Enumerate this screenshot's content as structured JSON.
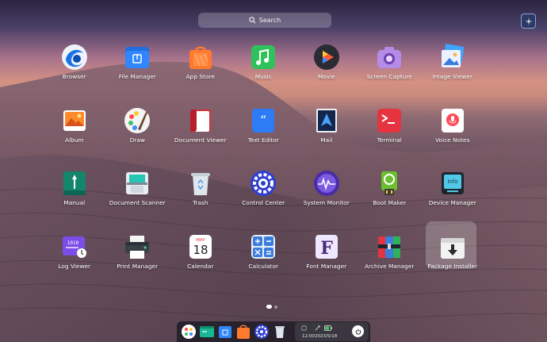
{
  "search": {
    "placeholder": "Search"
  },
  "apps": [
    {
      "label": "Browser",
      "icon": "browser-icon"
    },
    {
      "label": "File Manager",
      "icon": "file-manager-icon"
    },
    {
      "label": "App Store",
      "icon": "app-store-icon"
    },
    {
      "label": "Music",
      "icon": "music-icon"
    },
    {
      "label": "Movie",
      "icon": "movie-icon"
    },
    {
      "label": "Screen Capture",
      "icon": "camera-icon"
    },
    {
      "label": "Image Viewer",
      "icon": "image-viewer-icon"
    },
    {
      "label": "Album",
      "icon": "album-icon"
    },
    {
      "label": "Draw",
      "icon": "draw-icon"
    },
    {
      "label": "Document Viewer",
      "icon": "document-viewer-icon"
    },
    {
      "label": "Text Editor",
      "icon": "text-editor-icon"
    },
    {
      "label": "Mail",
      "icon": "mail-icon"
    },
    {
      "label": "Terminal",
      "icon": "terminal-icon"
    },
    {
      "label": "Voice Notes",
      "icon": "voice-notes-icon"
    },
    {
      "label": "Manual",
      "icon": "manual-icon"
    },
    {
      "label": "Document Scanner",
      "icon": "scanner-icon"
    },
    {
      "label": "Trash",
      "icon": "trash-icon"
    },
    {
      "label": "Control Center",
      "icon": "control-center-icon"
    },
    {
      "label": "System Monitor",
      "icon": "system-monitor-icon"
    },
    {
      "label": "Boot Maker",
      "icon": "boot-maker-icon"
    },
    {
      "label": "Device Manager",
      "icon": "device-manager-icon"
    },
    {
      "label": "Log Viewer",
      "icon": "log-viewer-icon"
    },
    {
      "label": "Print Manager",
      "icon": "printer-icon"
    },
    {
      "label": "Calendar",
      "icon": "calendar-icon"
    },
    {
      "label": "Calculator",
      "icon": "calculator-icon"
    },
    {
      "label": "Font Manager",
      "icon": "font-manager-icon"
    },
    {
      "label": "Archive Manager",
      "icon": "archive-icon"
    },
    {
      "label": "Package Installer",
      "icon": "package-installer-icon"
    }
  ],
  "icon_text": {
    "calendar_month": "MAY",
    "calendar_day": "18",
    "device_manager": "Info",
    "log_viewer": "1010",
    "font_manager": "F"
  },
  "selected_app": "Package Installer",
  "pager": {
    "pages": 2,
    "current": 1
  },
  "dock": {
    "items": [
      "launcher-icon",
      "terminal-icon",
      "file-manager-icon",
      "app-store-icon",
      "control-center-icon",
      "trash-icon"
    ]
  },
  "tray": {
    "time": "12:00",
    "date": "2023/5/18"
  },
  "colors": {
    "selection_highlight": "#ffffff38",
    "dock_background": "#1e1c24"
  }
}
